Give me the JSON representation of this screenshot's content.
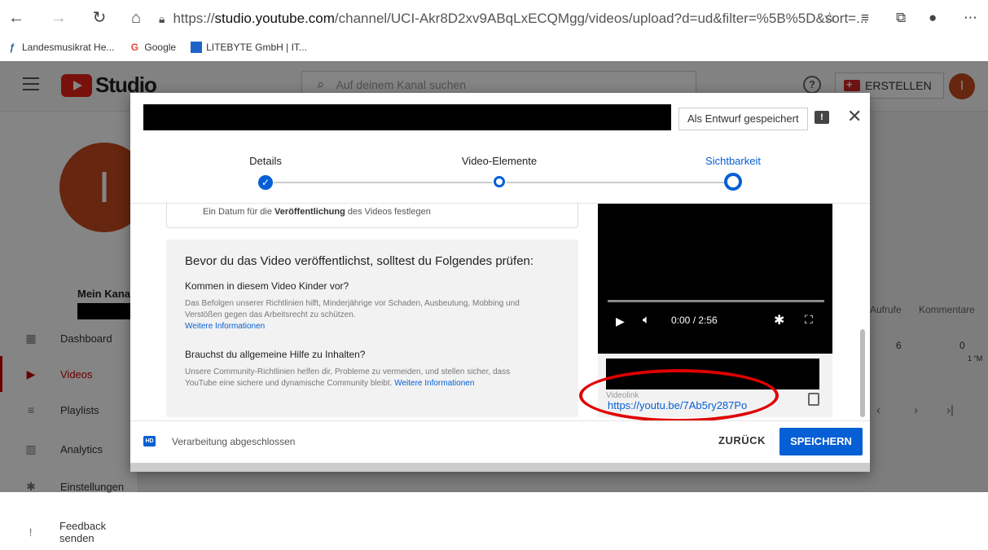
{
  "browser": {
    "url_prefix": "https://",
    "url_host": "studio.youtube.com",
    "url_path": "/channel/UCI-Akr8D2xv9ABqLxECQMgg/videos/upload?d=ud&filter=%5B%5D&sort=..."
  },
  "bookmarks": [
    {
      "label": "Landesmusikrat He..."
    },
    {
      "label": "Google"
    },
    {
      "label": "LITEBYTE GmbH | IT..."
    }
  ],
  "studio": {
    "logo": "Studio",
    "search_placeholder": "Auf deinem Kanal suchen",
    "create_label": "ERSTELLEN",
    "user_initial": "I"
  },
  "sidebar": {
    "channel_initial": "I",
    "channel_label": "Mein Kanal",
    "items": [
      {
        "label": "Dashboard"
      },
      {
        "label": "Videos"
      },
      {
        "label": "Playlists"
      },
      {
        "label": "Analytics"
      },
      {
        "label": "Einstellungen"
      },
      {
        "label": "Feedback senden"
      }
    ]
  },
  "table": {
    "col_views": "Aufrufe",
    "col_comments": "Kommentare",
    "views": "6",
    "comments": "0",
    "extra": "1 \"M"
  },
  "modal": {
    "draft_label": "Als Entwurf gespeichert",
    "steps": [
      {
        "label": "Details"
      },
      {
        "label": "Video-Elemente"
      },
      {
        "label": "Sichtbarkeit"
      }
    ],
    "schedule_text_pre": "Ein Datum für die ",
    "schedule_text_bold": "Veröffentlichung",
    "schedule_text_post": " des Videos festlegen",
    "info_title": "Bevor du das Video veröffentlichst, solltest du Folgendes prüfen:",
    "q1": "Kommen in diesem Video Kinder vor?",
    "t1": "Das Befolgen unserer Richtlinien hilft, Minderjährige vor Schaden, Ausbeutung, Mobbing und Verstößen gegen das Arbeitsrecht zu schützen.",
    "t1_link": "Weitere Informationen",
    "q2": "Brauchst du allgemeine Hilfe zu Inhalten?",
    "t2": "Unsere Community-Richtlinien helfen dir, Probleme zu vermeiden, und stellen sicher, dass YouTube eine sichere und dynamische Community bleibt. ",
    "t2_link": "Weitere Informationen",
    "video_time": "0:00 / 2:56",
    "video_progress": 0,
    "video_link_label": "Videolink",
    "video_url": "https://youtu.be/7Ab5ry287Po",
    "status": "Verarbeitung abgeschlossen",
    "back_label": "ZURÜCK",
    "save_label": "SPEICHERN"
  }
}
